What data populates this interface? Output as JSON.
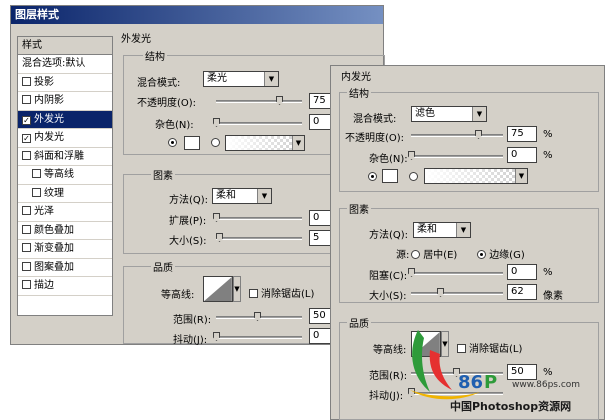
{
  "window": {
    "title": "图层样式"
  },
  "style_list": {
    "header": "样式",
    "blend_options": "混合选项:默认",
    "items": [
      {
        "label": "投影",
        "checked": false,
        "selected": false,
        "indent": false
      },
      {
        "label": "内阴影",
        "checked": false,
        "selected": false,
        "indent": false
      },
      {
        "label": "外发光",
        "checked": true,
        "selected": true,
        "indent": false
      },
      {
        "label": "内发光",
        "checked": true,
        "selected": false,
        "indent": false
      },
      {
        "label": "斜面和浮雕",
        "checked": false,
        "selected": false,
        "indent": false
      },
      {
        "label": "等高线",
        "checked": false,
        "selected": false,
        "indent": true
      },
      {
        "label": "纹理",
        "checked": false,
        "selected": false,
        "indent": true
      },
      {
        "label": "光泽",
        "checked": false,
        "selected": false,
        "indent": false
      },
      {
        "label": "颜色叠加",
        "checked": false,
        "selected": false,
        "indent": false
      },
      {
        "label": "渐变叠加",
        "checked": false,
        "selected": false,
        "indent": false
      },
      {
        "label": "图案叠加",
        "checked": false,
        "selected": false,
        "indent": false
      },
      {
        "label": "描边",
        "checked": false,
        "selected": false,
        "indent": false
      }
    ]
  },
  "outer_glow": {
    "title": "外发光",
    "structure": {
      "title": "结构",
      "blend_mode_label": "混合模式:",
      "blend_mode_value": "柔光",
      "opacity_label": "不透明度(O):",
      "opacity_value": "75",
      "opacity_level": 75,
      "noise_label": "杂色(N):",
      "noise_value": "0",
      "noise_level": 0
    },
    "elements": {
      "title": "图素",
      "method_label": "方法(Q):",
      "method_value": "柔和",
      "spread_label": "扩展(P):",
      "spread_value": "0",
      "size_label": "大小(S):",
      "size_value": "5"
    },
    "quality": {
      "title": "品质",
      "contour_label": "等高线:",
      "antialias_label": "消除锯齿(L)",
      "range_label": "范围(R):",
      "range_value": "50",
      "jitter_label": "抖动(J):",
      "jitter_value": "0"
    }
  },
  "inner_glow": {
    "title": "内发光",
    "structure": {
      "title": "结构",
      "blend_mode_label": "混合模式:",
      "blend_mode_value": "滤色",
      "opacity_label": "不透明度(O):",
      "opacity_value": "75",
      "opacity_unit": "%",
      "noise_label": "杂色(N):",
      "noise_value": "0",
      "noise_unit": "%"
    },
    "elements": {
      "title": "图素",
      "method_label": "方法(Q):",
      "method_value": "柔和",
      "source_label": "源:",
      "source_center": "居中(E)",
      "source_edge": "边缘(G)",
      "choke_label": "阻塞(C):",
      "choke_value": "0",
      "choke_unit": "%",
      "size_label": "大小(S):",
      "size_value": "62",
      "size_unit": "像素"
    },
    "quality": {
      "title": "品质",
      "contour_label": "等高线:",
      "antialias_label": "消除锯齿(L)",
      "range_label": "范围(R):",
      "range_value": "50",
      "range_unit": "%",
      "jitter_label": "抖动(J):"
    }
  },
  "watermark": {
    "site": "www.86ps.com",
    "brand": "中国Photoshop资源网"
  },
  "colors": {
    "title_bar": "#0a246a",
    "selected": "#0a246a",
    "dialog_bg": "#d4d0c8"
  }
}
